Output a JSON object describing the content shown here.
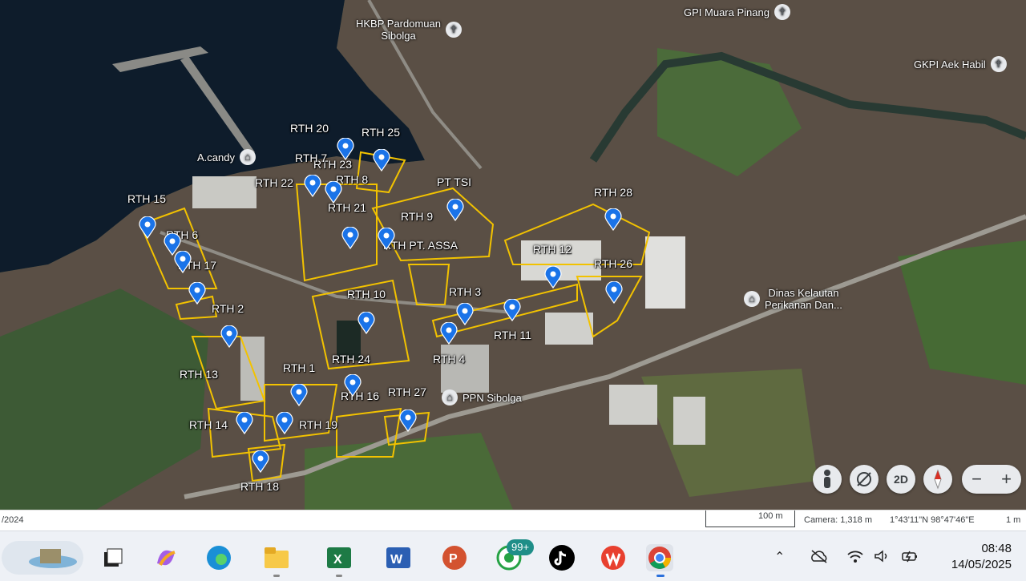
{
  "map": {
    "placemarks": [
      {
        "label": "RTH 20",
        "pin": false
      },
      {
        "label": "RTH 25",
        "pin": false
      },
      {
        "label": "RTH 23",
        "pin": true
      },
      {
        "label": "RTH 7",
        "pin": false
      },
      {
        "label": "RTH 8",
        "pin": true
      },
      {
        "label": "RTH 22",
        "pin": true
      },
      {
        "label": "RTH 21",
        "pin": true
      },
      {
        "label": "RTH 15",
        "pin": true
      },
      {
        "label": "RTH 6",
        "pin": true
      },
      {
        "label": "RTH 17",
        "pin": true
      },
      {
        "label": "RTH 2",
        "pin": true
      },
      {
        "label": "RTH 9",
        "pin": true
      },
      {
        "label": "RTH PT. ASSA",
        "pin": true
      },
      {
        "label": "PT TSI",
        "pin": false
      },
      {
        "label": "RTH 28",
        "pin": true
      },
      {
        "label": "RTH 12",
        "pin": true
      },
      {
        "label": "RTH 26",
        "pin": true
      },
      {
        "label": "RTH 3",
        "pin": true
      },
      {
        "label": "RTH 10",
        "pin": true
      },
      {
        "label": "RTH 11",
        "pin": true
      },
      {
        "label": "RTH 4",
        "pin": true
      },
      {
        "label": "RTH 24",
        "pin": true
      },
      {
        "label": "RTH 1",
        "pin": true
      },
      {
        "label": "RTH 13",
        "pin": true
      },
      {
        "label": "RTH 16",
        "pin": true
      },
      {
        "label": "RTH 27",
        "pin": true
      },
      {
        "label": "RTH 14",
        "pin": true
      },
      {
        "label": "RTH 19",
        "pin": true
      },
      {
        "label": "RTH 18",
        "pin": true
      }
    ],
    "pois": [
      {
        "label": "HKBP Pardomuan\nSibolga",
        "icon": "church-icon"
      },
      {
        "label": "GPI Muara Pinang",
        "icon": "church-icon"
      },
      {
        "label": "GKPI Aek Habil",
        "icon": "church-icon"
      },
      {
        "label": "A.candy",
        "icon": "bank-icon"
      },
      {
        "label": "Dinas Kelautan\nPerikanan Dan...",
        "icon": "government-icon"
      },
      {
        "label": "PPN Sibolga",
        "icon": "government-icon"
      }
    ]
  },
  "controls": {
    "pegman": "pegman-icon",
    "tilt": "tilt-icon",
    "view_mode": "2D",
    "compass": "compass-icon",
    "zoom_out": "−",
    "zoom_in": "+"
  },
  "status": {
    "date": "/2024",
    "scale": "100 m",
    "camera": "Camera: 1,318 m",
    "coords": "1°43'11\"N 98°47'46\"E",
    "elevation": "1 m"
  },
  "taskbar": {
    "apps": [
      "search-widget",
      "task-view",
      "copilot",
      "edge",
      "file-explorer",
      "excel",
      "word",
      "powerpoint",
      "whatsapp",
      "tiktok",
      "wps-office",
      "chrome"
    ],
    "whatsapp_badge": "99+",
    "time": "08:48",
    "date": "14/05/2025"
  },
  "colors": {
    "outline": "#f2c200",
    "pin": "#1a73e8",
    "sea": "#0e1c2b"
  }
}
